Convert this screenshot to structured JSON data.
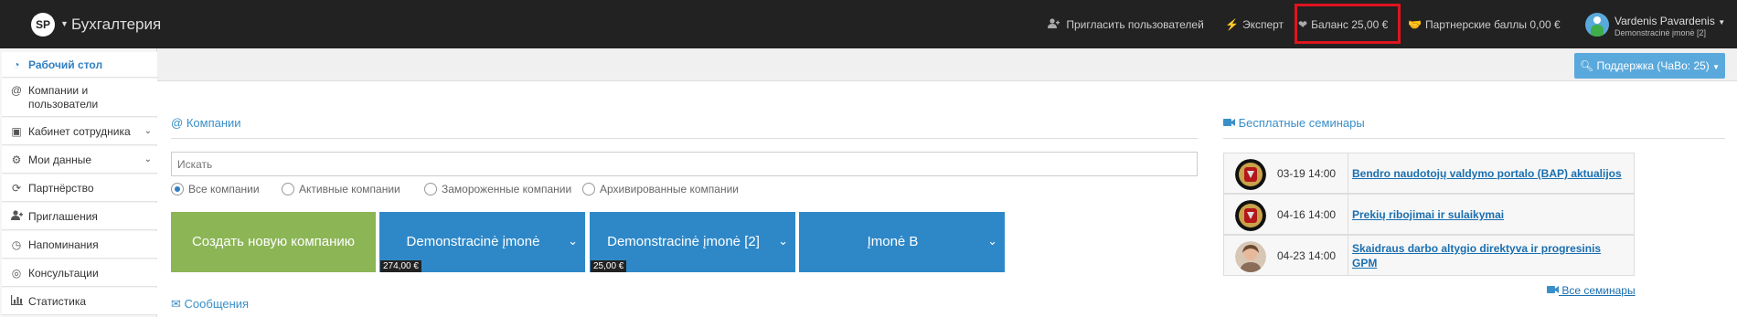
{
  "topbar": {
    "logo_text": "SP",
    "app_title": "Бухгалтерия",
    "invite_users": "Пригласить пользователей",
    "expert": "Эксперт",
    "balance": "Баланс 25,00 €",
    "partner_points": "Партнерские баллы 0,00 €",
    "user_name": "Vardenis Pavardenis",
    "user_company": "Demonstracinė įmonė [2]"
  },
  "sidebar": {
    "items": [
      {
        "label": "Рабочий стол",
        "icon": "dashboard-icon"
      },
      {
        "label": "Компании и",
        "label2": "пользователи",
        "icon": "at-icon"
      },
      {
        "label": "Кабинет сотрудника",
        "icon": "id-card-icon"
      },
      {
        "label": "Мои данные",
        "icon": "gears-icon"
      },
      {
        "label": "Партнёрство",
        "icon": "handshake-icon"
      },
      {
        "label": "Приглашения",
        "icon": "user-plus-icon"
      },
      {
        "label": "Напоминания",
        "icon": "clock-icon"
      },
      {
        "label": "Консультации",
        "icon": "lifebuoy-icon"
      },
      {
        "label": "Статистика",
        "icon": "bar-chart-icon"
      }
    ]
  },
  "support_button": "Поддержка (ЧаВо: 25)",
  "companies": {
    "title": "Компании",
    "search_placeholder": "Искать",
    "filters": [
      "Все компании",
      "Активные компании",
      "Замороженные компании",
      "Архивированные компании"
    ],
    "create_button": "Создать новую компанию",
    "tiles": [
      {
        "label": "Demonstracinė įmonė",
        "amount": "274,00 €"
      },
      {
        "label": "Demonstracinė įmonė [2]",
        "amount": "25,00 €"
      },
      {
        "label": "Įmonė B",
        "amount": ""
      }
    ]
  },
  "messages_title": "Сообщения",
  "seminars": {
    "title": "Бесплатные семинары",
    "rows": [
      {
        "date": "03-19 14:00",
        "title": "Bendro naudotojų valdymo portalo (BAP) aktualijos",
        "image": "emblem"
      },
      {
        "date": "04-16 14:00",
        "title": "Prekių ribojimai ir sulaikymai",
        "image": "emblem"
      },
      {
        "date": "04-23 14:00",
        "title": "Skaidraus darbo altygio direktyva ir progresinis GPM",
        "image": "portrait"
      }
    ],
    "all_link": "Все семинары"
  },
  "colors": {
    "topbar": "#222222",
    "accent": "#2f7fc1",
    "create_tile": "#8cb556",
    "company_tile": "#2e88c8",
    "highlight": "#e0141e"
  }
}
